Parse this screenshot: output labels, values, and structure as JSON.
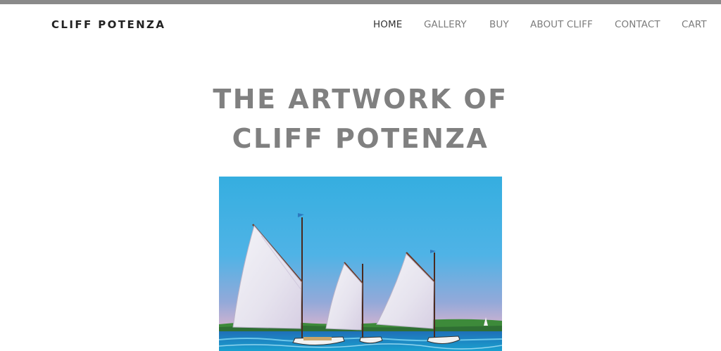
{
  "header": {
    "brand": "CLIFF POTENZA",
    "nav": [
      {
        "label": "HOME",
        "active": true
      },
      {
        "label": "GALLERY",
        "active": false
      },
      {
        "label": "BUY",
        "active": false
      },
      {
        "label": "ABOUT CLIFF",
        "active": false
      },
      {
        "label": "CONTACT",
        "active": false
      },
      {
        "label": "CART",
        "active": false
      }
    ]
  },
  "hero": {
    "title_line1": "THE ARTWORK OF",
    "title_line2": "CLIFF POTENZA"
  },
  "colors": {
    "top_bar": "#8a8a8a",
    "brand_text": "#222222",
    "nav_text": "#7c7c7c",
    "nav_active": "#333333",
    "title_text": "#808080"
  }
}
